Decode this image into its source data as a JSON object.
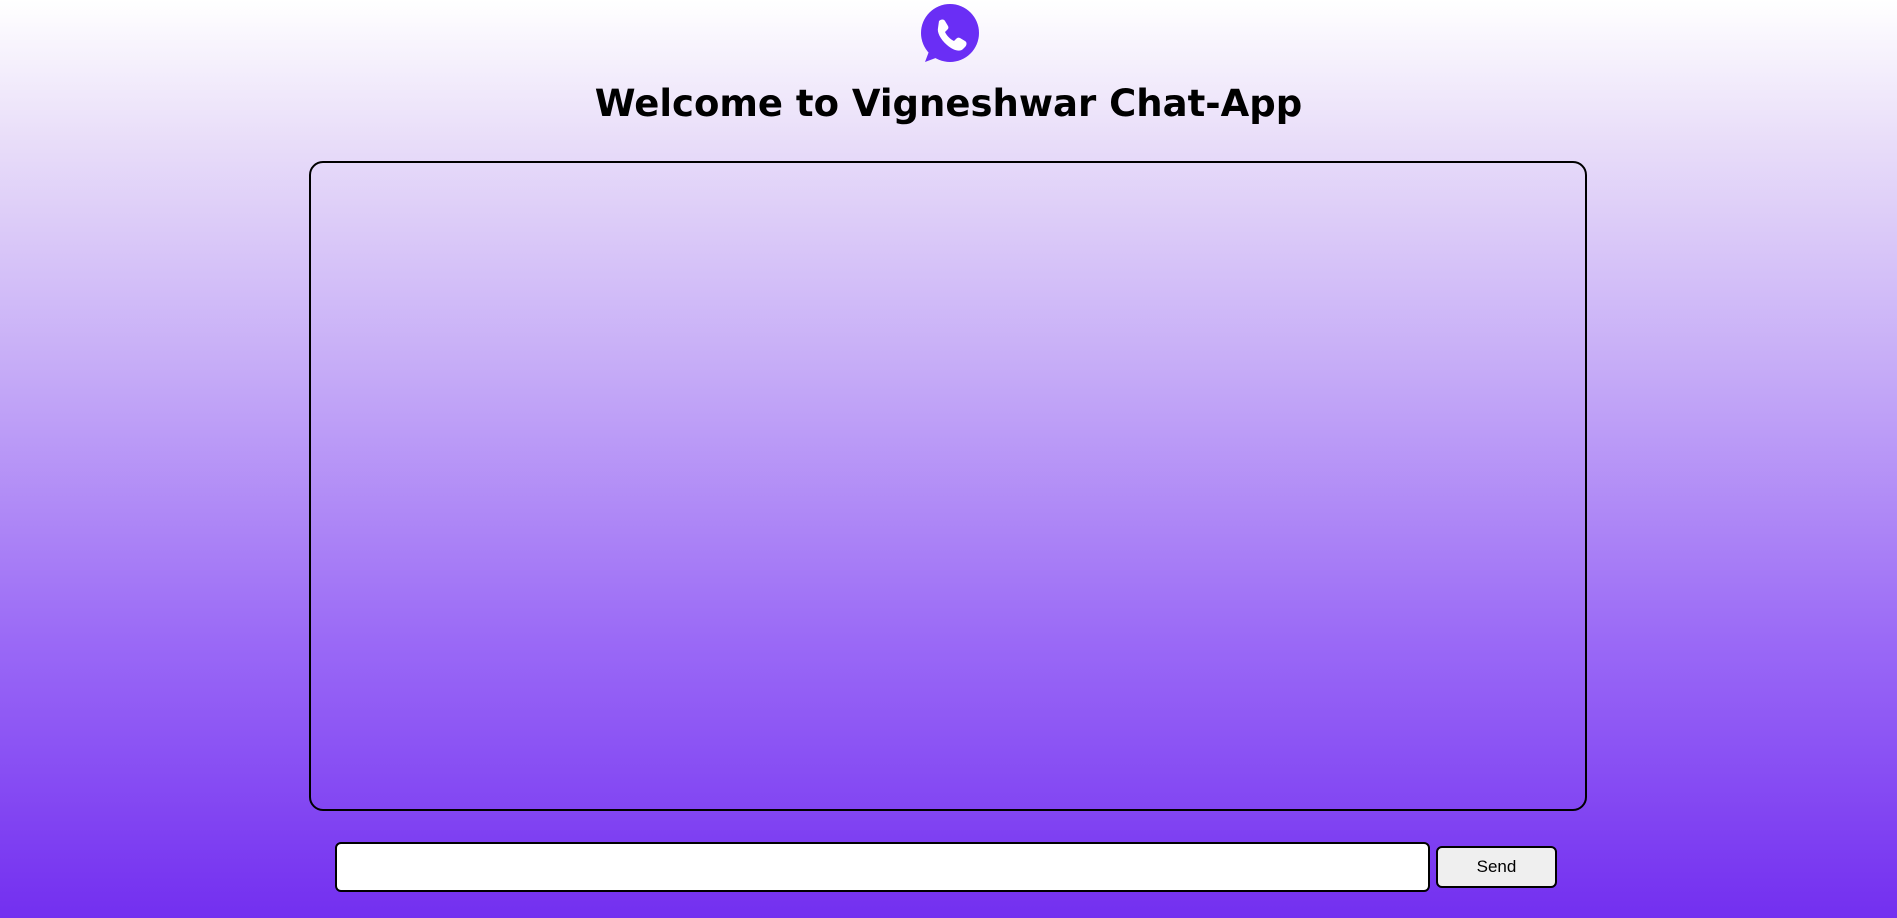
{
  "header": {
    "logo_icon": "whatsapp-phone-icon",
    "title": "Welcome to Vigneshwar Chat-App"
  },
  "chat": {
    "messages": []
  },
  "composer": {
    "input_value": "",
    "input_placeholder": "",
    "send_label": "Send"
  },
  "colors": {
    "accent": "#732ff0",
    "logo": "#6a2ef5",
    "gradient_top": "#ffffff",
    "gradient_bottom": "#732ff0"
  }
}
